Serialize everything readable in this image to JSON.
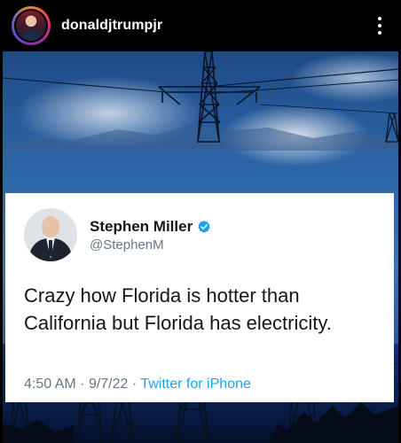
{
  "post": {
    "username": "donaldjtrumpjr",
    "more_icon": "more-vertical-icon"
  },
  "tweet": {
    "author_name": "Stephen Miller",
    "author_handle": "@StephenM",
    "verified_icon": "verified-badge-icon",
    "text": "Crazy how Florida is hotter than California but Florida has electricity.",
    "time": "4:50 AM",
    "separator": "·",
    "date": "9/7/22",
    "source": "Twitter for iPhone"
  },
  "colors": {
    "tweet_source": "#1da1f2",
    "verified": "#1da1f2",
    "meta_gray": "#657786",
    "text": "#14171a"
  }
}
